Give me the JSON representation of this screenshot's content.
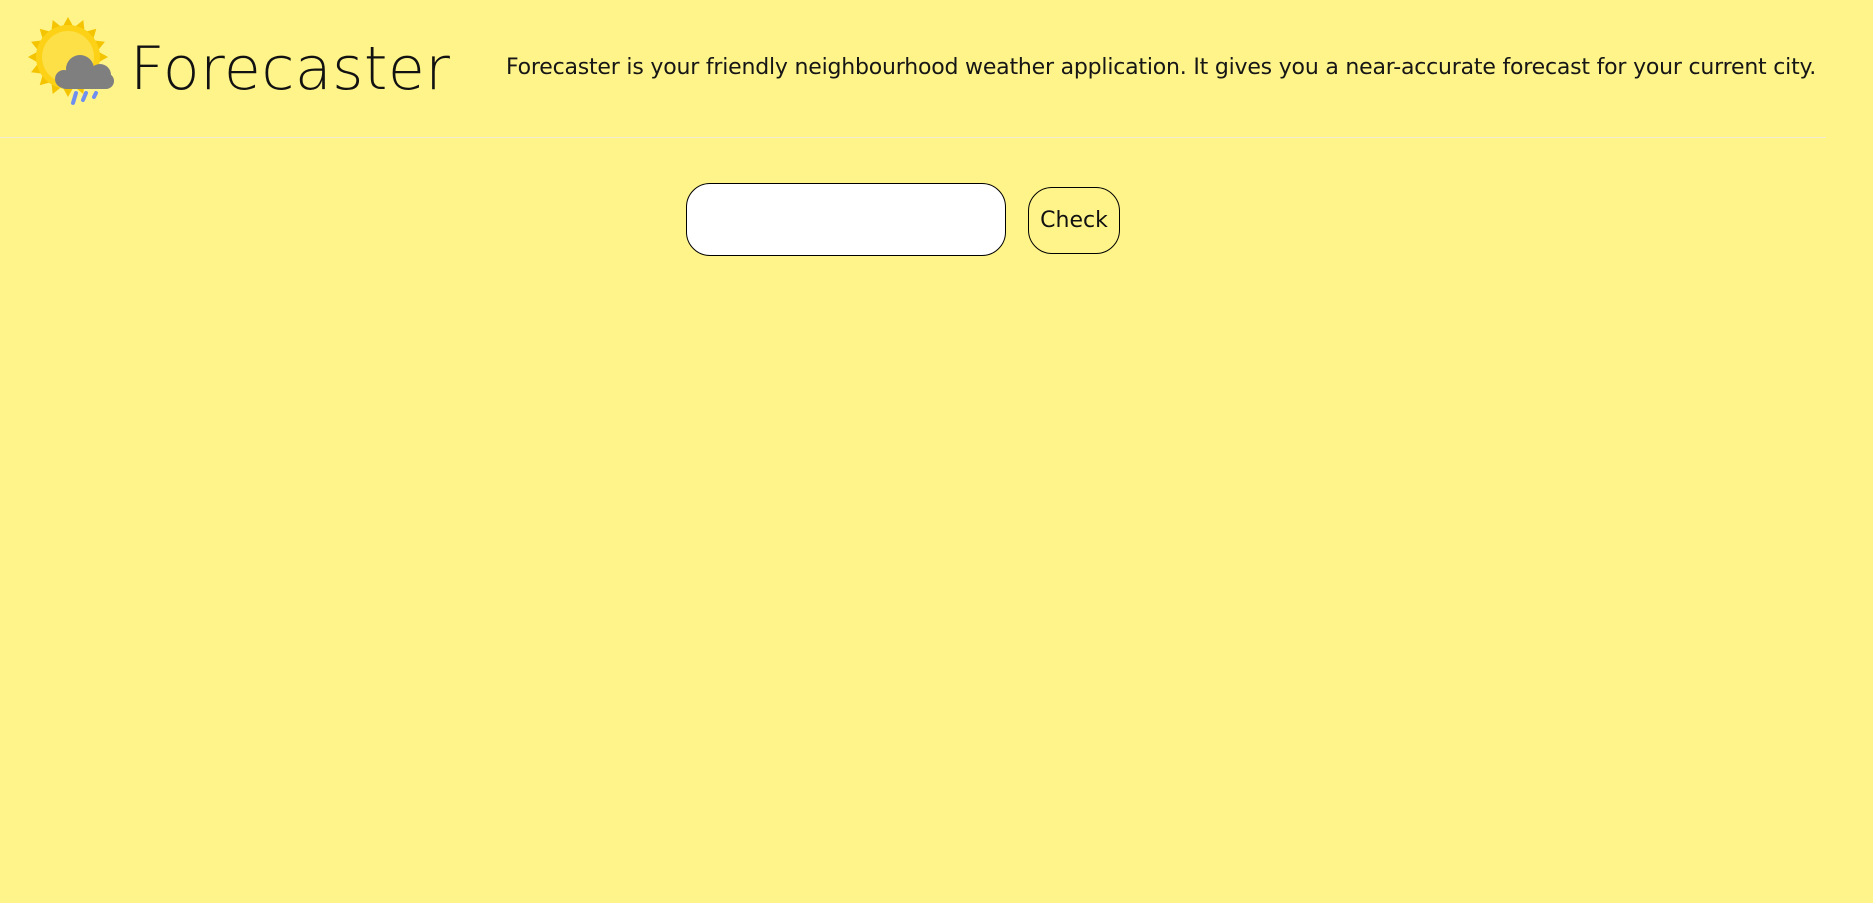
{
  "header": {
    "logo_icon": "sun-cloud-rain-icon",
    "title": "Forecaster",
    "tagline": "Forecaster is your friendly neighbourhood weather application. It gives you a near-accurate forecast for your current city."
  },
  "search": {
    "value": "",
    "placeholder": "",
    "button_label": "Check"
  },
  "colors": {
    "background": "#fef48a",
    "sun": "#fcd116",
    "cloud": "#7f7f7f",
    "rain": "#6f8ff0"
  }
}
